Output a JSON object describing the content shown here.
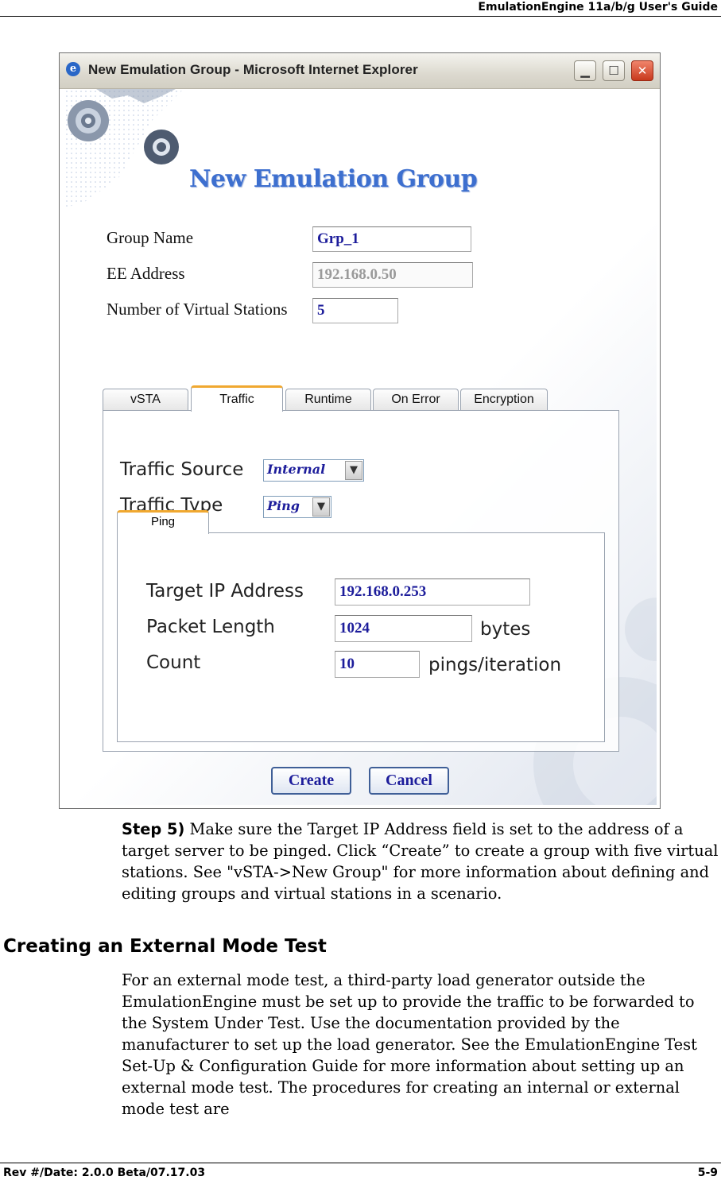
{
  "header": {
    "title": "EmulationEngine 11a/b/g User's Guide"
  },
  "window": {
    "title": "New Emulation Group - Microsoft Internet Explorer",
    "icon": "ie-icon",
    "controls": {
      "minimize": "▁",
      "maximize": "☐",
      "close": "✕"
    }
  },
  "form": {
    "heading": "New Emulation Group",
    "group_name_label": "Group Name",
    "group_name_value": "Grp_1",
    "ee_address_label": "EE Address",
    "ee_address_value": "192.168.0.50",
    "num_stations_label": "Number of Virtual Stations",
    "num_stations_value": "5"
  },
  "tabs": [
    "vSTA",
    "Traffic",
    "Runtime",
    "On Error",
    "Encryption"
  ],
  "active_tab": "Traffic",
  "traffic": {
    "source_label": "Traffic Source",
    "source_value": "Internal",
    "type_label": "Traffic Type",
    "type_value": "Ping",
    "subtab": "Ping",
    "target_ip_label": "Target IP Address",
    "target_ip_value": "192.168.0.253",
    "packet_length_label": "Packet Length",
    "packet_length_value": "1024",
    "packet_length_unit": "bytes",
    "count_label": "Count",
    "count_value": "10",
    "count_unit": "pings/iteration"
  },
  "buttons": {
    "create": "Create",
    "cancel": "Cancel"
  },
  "body": {
    "step_label": "Step 5)",
    "step_text": " Make sure the Target IP Address field is set to the address of a target server to be pinged. Click “Create” to create a group with five virtual stations. See \"vSTA->New Group\" for more information about defining and editing groups and virtual stations in a scenario.",
    "section_heading": "Creating an External Mode Test",
    "section_text": "For an external mode test, a third-party load generator outside the EmulationEngine must be set up to provide the traffic to be forwarded to the System Under Test. Use the documentation provided by the manufacturer to set up the load generator. See the EmulationEngine Test Set-Up & Configuration Guide for more information about setting up an external mode test. The procedures for creating an internal or external mode test are"
  },
  "footer": {
    "left": "Rev #/Date: 2.0.0 Beta/07.17.03",
    "right": "5-9"
  },
  "colors": {
    "accent": "#3d6fcf",
    "field_text": "#1d1d9b",
    "tab_highlight": "#f0a830"
  }
}
